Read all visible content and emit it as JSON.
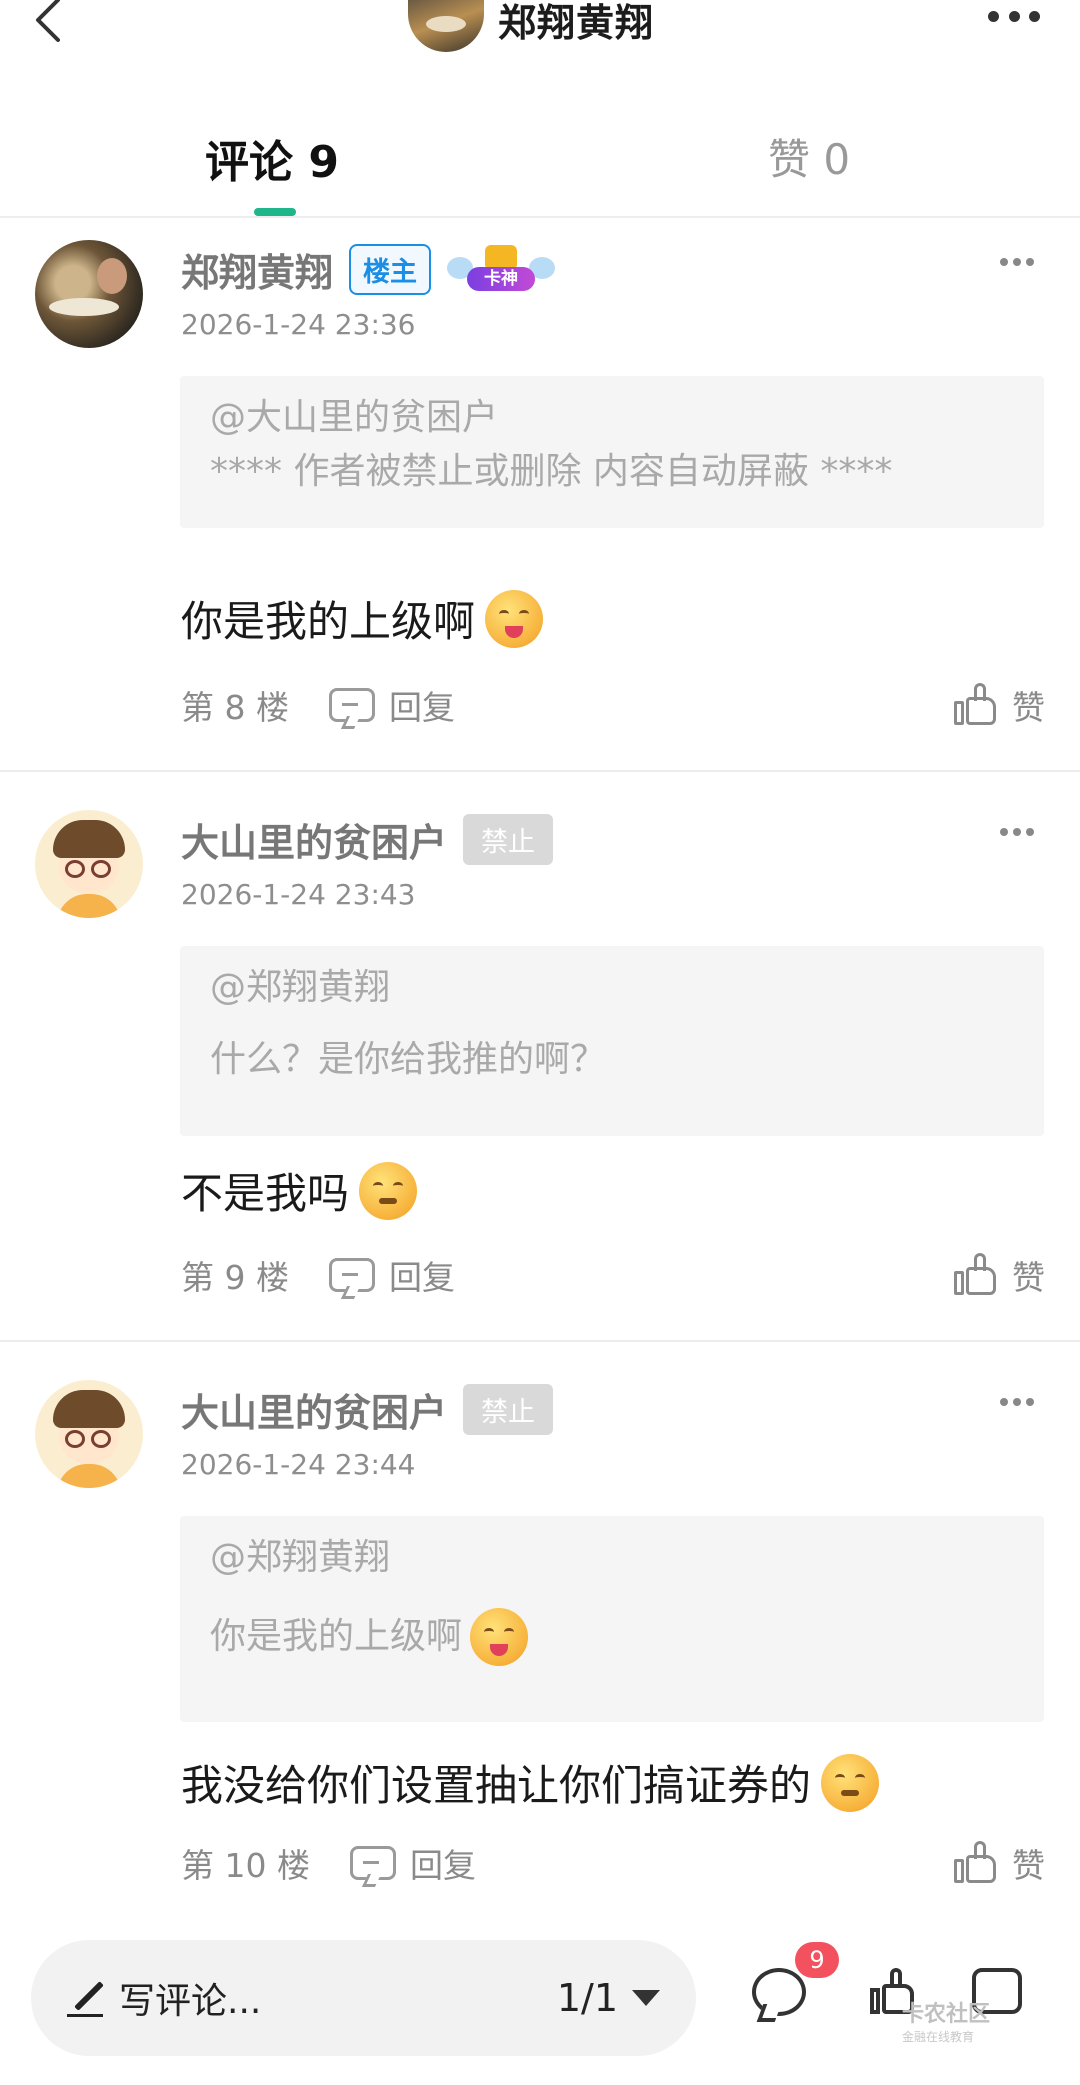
{
  "header": {
    "title": "郑翔黄翔"
  },
  "tabs": [
    {
      "label": "评论 9"
    },
    {
      "label": "赞 0"
    }
  ],
  "comments": [
    {
      "username": "郑翔黄翔",
      "badge": "楼主",
      "title_badge": "卡神",
      "timestamp": "2026-1-24 23:36",
      "quote_at": "@大山里的贫困户",
      "quote_text": "**** 作者被禁止或删除 内容自动屏蔽 ****",
      "content": "你是我的上级啊",
      "floor": "第 8 楼",
      "reply_label": "回复",
      "like_label": "赞"
    },
    {
      "username": "大山里的贫困户",
      "badge": "禁止",
      "timestamp": "2026-1-24 23:43",
      "quote_at": "@郑翔黄翔",
      "quote_text": "什么？是你给我推的啊？",
      "content": "不是我吗",
      "floor": "第 9 楼",
      "reply_label": "回复",
      "like_label": "赞"
    },
    {
      "username": "大山里的贫困户",
      "badge": "禁止",
      "timestamp": "2026-1-24 23:44",
      "quote_at": "@郑翔黄翔",
      "quote_text": "你是我的上级啊",
      "content": "我没给你们设置抽让你们搞证券的",
      "floor": "第 10 楼",
      "reply_label": "回复",
      "like_label": "赞"
    }
  ],
  "bottom_bar": {
    "compose_placeholder": "写评论...",
    "page_indicator": "1/1",
    "comment_count": "9",
    "watermark_title": "卡农社区",
    "watermark_subtitle": "金融在线教育"
  },
  "colors": {
    "accent": "#1fb68b",
    "owner_badge": "#1a8fe3",
    "banned_badge": "#d9d9d9",
    "count_badge": "#f4515f"
  }
}
